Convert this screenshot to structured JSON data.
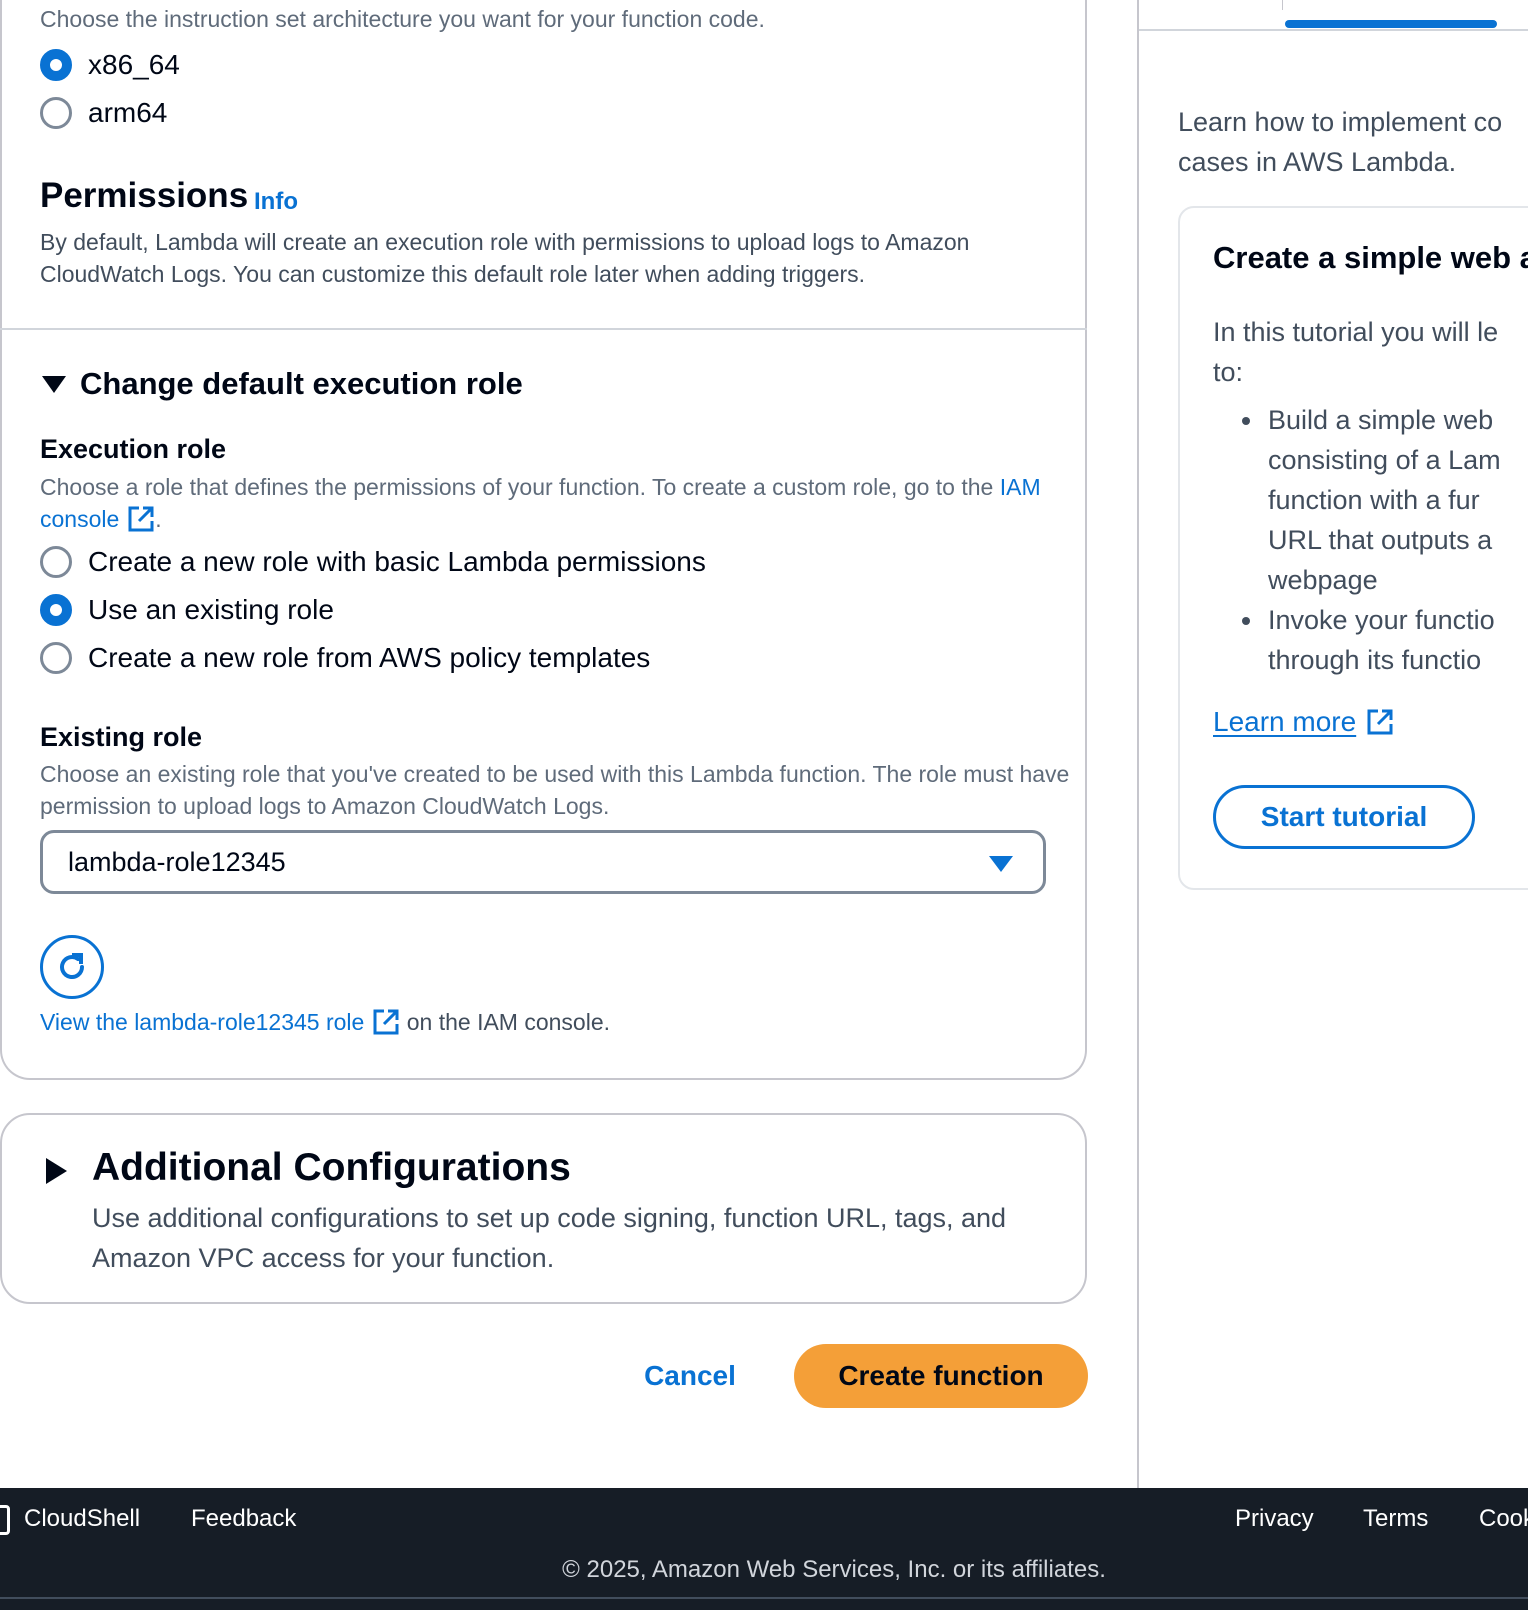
{
  "architecture": {
    "description": "Choose the instruction set architecture you want for your function code.",
    "options": [
      {
        "label": "x86_64",
        "checked": true
      },
      {
        "label": "arm64",
        "checked": false
      }
    ]
  },
  "permissions": {
    "title": "Permissions",
    "info_label": "Info",
    "description": "By default, Lambda will create an execution role with permissions to upload logs to Amazon CloudWatch Logs. You can customize this default role later when adding triggers."
  },
  "execution_role_section": {
    "expander_label": "Change default execution role",
    "label": "Execution role",
    "description_prefix": "Choose a role that defines the permissions of your function. To create a custom role, go to the ",
    "iam_console_link": "IAM console",
    "description_suffix": ".",
    "options": [
      {
        "label": "Create a new role with basic Lambda permissions",
        "checked": false
      },
      {
        "label": "Use an existing role",
        "checked": true
      },
      {
        "label": "Create a new role from AWS policy templates",
        "checked": false
      }
    ]
  },
  "existing_role": {
    "label": "Existing role",
    "description": "Choose an existing role that you've created to be used with this Lambda function. The role must have permission to upload logs to Amazon CloudWatch Logs.",
    "selected_value": "lambda-role12345",
    "view_link": "View the lambda-role12345 role",
    "view_suffix": "on the IAM console."
  },
  "additional_config": {
    "title": "Additional Configurations",
    "description": "Use additional configurations to set up code signing, function URL, tags, and Amazon VPC access for your function."
  },
  "actions": {
    "cancel_label": "Cancel",
    "create_label": "Create function"
  },
  "side_panel": {
    "intro_line1": "Learn how to implement co",
    "intro_line2": "cases in AWS Lambda.",
    "tutorial_title": "Create a simple web a",
    "tutorial_desc_line1": "In this tutorial you will le",
    "tutorial_desc_line2": "to:",
    "bullets": [
      [
        "Build a simple web",
        "consisting of a Lam",
        "function with a fur",
        "URL that outputs a",
        "webpage"
      ],
      [
        "Invoke your functio",
        "through its functio"
      ]
    ],
    "learn_more": "Learn more",
    "start_tutorial": "Start tutorial"
  },
  "footer": {
    "cloudshell": "CloudShell",
    "feedback": "Feedback",
    "privacy": "Privacy",
    "terms": "Terms",
    "cookies": "Cook",
    "copyright": "© 2025, Amazon Web Services, Inc. or its affiliates."
  },
  "colors": {
    "accent": "#0972d3",
    "primary_button": "#f49f38",
    "footer_bg": "#161d26"
  }
}
